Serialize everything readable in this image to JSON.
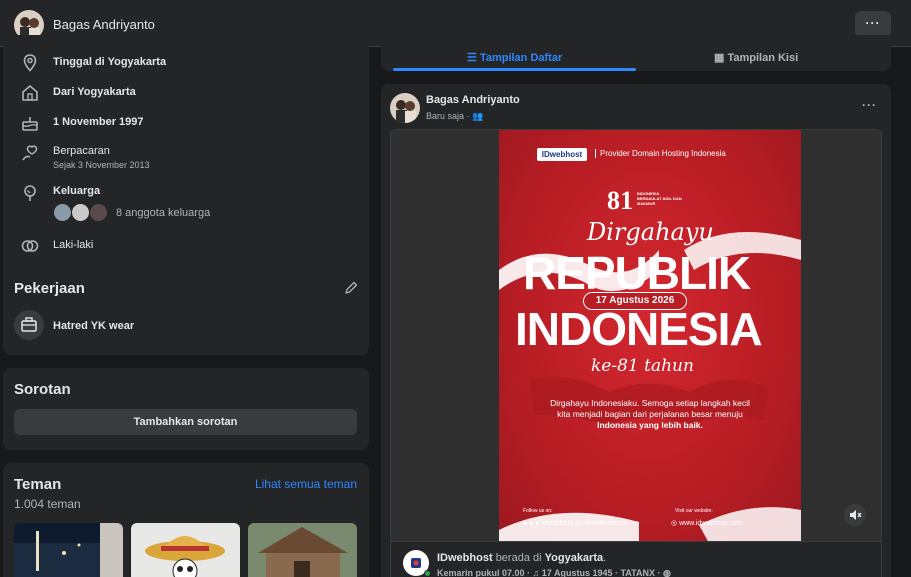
{
  "topbar": {
    "name": "Bagas Andriyanto",
    "more_label": "···",
    "avatar_icon": "profile-avatar"
  },
  "intro": {
    "items": [
      {
        "icon": "location-pin-icon",
        "text": "Tinggal di Yogyakarta"
      },
      {
        "icon": "home-icon",
        "text": "Dari Yogyakarta"
      },
      {
        "icon": "birthday-cake-icon",
        "text": "1 November 1997"
      },
      {
        "icon": "relationship-icon",
        "text": "Berpacaran",
        "sub": "Sejak 3 November 2013"
      },
      {
        "icon": "family-tree-icon",
        "text": "Keluarga",
        "family_count": "8 anggota keluarga"
      },
      {
        "icon": "gender-icon",
        "text": "Laki-laki"
      }
    ]
  },
  "work": {
    "title": "Pekerjaan",
    "job": "Hatred YK wear",
    "icon": "briefcase-icon",
    "edit_icon": "pencil-icon"
  },
  "highlights": {
    "title": "Sorotan",
    "add_button": "Tambahkan sorotan"
  },
  "friends": {
    "title": "Teman",
    "see_all": "Lihat semua teman",
    "count": "1.004 teman"
  },
  "view_tabs": {
    "list_view": "Tampilan Daftar",
    "grid_view": "Tampilan Kisi"
  },
  "post": {
    "author": "Bagas Andriyanto",
    "time": "Baru saja",
    "separator": "·",
    "audience_icon": "friends-icon",
    "more_label": "···",
    "media": {
      "brand": "IDwebhost",
      "tagline": "Provider Domain Hosting Indonesia",
      "anniv_number": "81",
      "anniv_tagline": "INDONESIA BERDAULAT ADIL DAN MAKMUR",
      "script_top": "Dirgahayu",
      "headline_1": "REPUBLIK",
      "headline_2": "INDONESIA",
      "date_pill": "17 Agustus 2026",
      "script_bottom": "ke-81 tahun",
      "message_line1": "Dirgahayu Indonesiaku. Semoga setiap langkah kecil",
      "message_line2": "kita menjadi bagian dari perjalanan besar menuju",
      "message_line3": "Indonesia yang lebih baik.",
      "follow_label": "Follow us on:",
      "follow_handle": "idwebhost",
      "instagram_handle": "idwebhostcom",
      "website_label": "Visit our website:",
      "website": "www.idwebhost.com",
      "colors": {
        "red": "#c8202a",
        "white": "#ffffff"
      }
    },
    "checkin": {
      "page": "IDwebhost",
      "connector": "berada di",
      "place": "Yogyakarta",
      "meta": "Kemarin pukul 07.00 · ♫ 17 Agustus 1945 · TATANX ·"
    }
  },
  "colors": {
    "background": "#18191a",
    "card": "#242526",
    "accent": "#2d88ff",
    "text": "#e4e6eb",
    "muted": "#b0b3b8"
  }
}
